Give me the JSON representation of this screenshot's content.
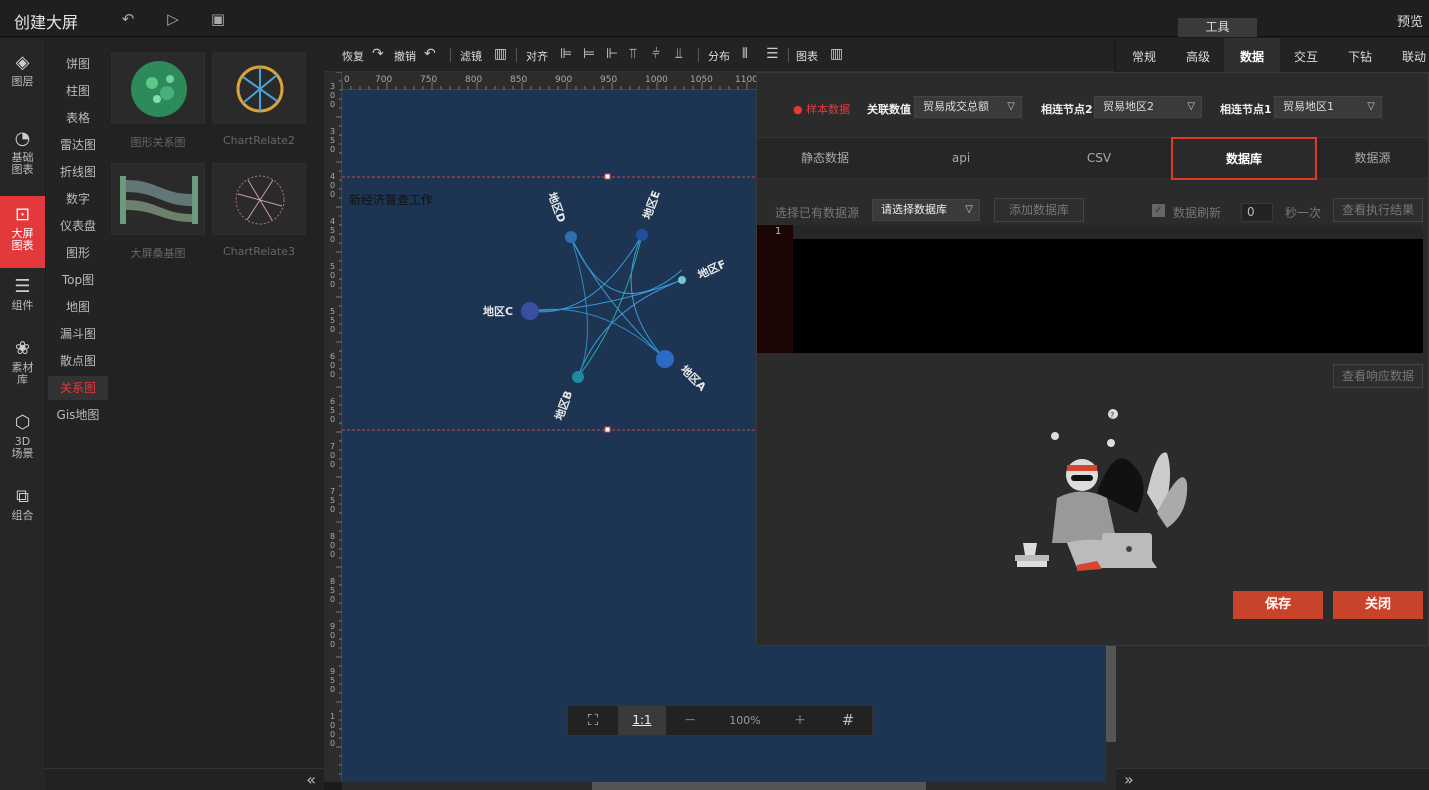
{
  "app": {
    "title": "创建大屏",
    "preview": "预览",
    "tools_tab": "工具"
  },
  "leftnav": [
    {
      "label1": "图层",
      "label2": ""
    },
    {
      "label1": "基础",
      "label2": "图表"
    },
    {
      "label1": "大屏",
      "label2": "图表"
    },
    {
      "label1": "组件",
      "label2": ""
    },
    {
      "label1": "素材",
      "label2": "库"
    },
    {
      "label1": "3D",
      "label2": "场景"
    },
    {
      "label1": "组合",
      "label2": ""
    }
  ],
  "categories": [
    "饼图",
    "柱图",
    "表格",
    "雷达图",
    "折线图",
    "数字",
    "仪表盘",
    "图形",
    "Top图",
    "地图",
    "漏斗图",
    "散点图",
    "关系图",
    "Gis地图"
  ],
  "thumbs": [
    "图形关系图",
    "ChartRelate2",
    "大屏桑基图",
    "ChartRelate3"
  ],
  "toolbar": {
    "redo": "恢复",
    "undo": "撤销",
    "filter": "滤镜",
    "align": "对齐",
    "distribute": "分布",
    "chart": "图表"
  },
  "ruler": {
    "ticks": [
      "0",
      "700",
      "750",
      "800",
      "850",
      "900",
      "950",
      "1000",
      "1050",
      "1100"
    ],
    "left_ticks": [
      "300",
      "350",
      "400",
      "450",
      "500",
      "550",
      "600",
      "650",
      "700",
      "750",
      "800",
      "850",
      "900",
      "950",
      "1000"
    ]
  },
  "canvas": {
    "chart_title": "新经济普查工作",
    "nodes": [
      "地区D",
      "地区E",
      "地区F",
      "地区C",
      "地区A",
      "地区B"
    ]
  },
  "zoom": {
    "ratio": "1:1",
    "minus": "−",
    "percent": "100%",
    "plus": "+"
  },
  "right_tabs": [
    "常规",
    "高级",
    "数据",
    "交互",
    "下钻",
    "联动"
  ],
  "dialog": {
    "sample": "样本数据",
    "assoc_label": "关联数值",
    "assoc_value": "贸易成交总额",
    "node2_label": "相连节点2",
    "node2_value": "贸易地区2",
    "node1_label": "相连节点1",
    "node1_value": "贸易地区1",
    "tabs": [
      "静态数据",
      "api",
      "CSV",
      "数据库",
      "数据源"
    ],
    "ds_label": "选择已有数据源",
    "ds_placeholder": "请选择数据库",
    "add_db": "添加数据库",
    "refresh_label": "数据刷新",
    "refresh_value": "0",
    "per_second": "秒一次",
    "view_exec": "查看执行结果",
    "line_number": "1",
    "view_response": "查看响应数据",
    "save": "保存",
    "close": "关闭"
  },
  "colors": {
    "accent": "#e4393c",
    "canvas": "#1d3452",
    "button": "#c9432b"
  }
}
